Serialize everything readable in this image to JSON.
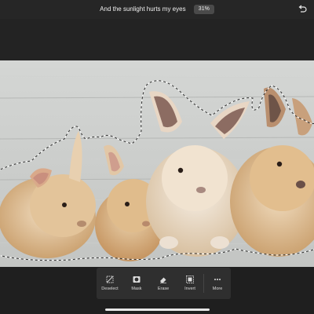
{
  "header": {
    "title": "And the sunlight hurts my eyes",
    "zoom": "31%",
    "undo_icon": "undo-arrow-icon"
  },
  "toolbar": {
    "items": [
      {
        "label": "Deselect",
        "icon": "deselect-icon"
      },
      {
        "label": "Mask",
        "icon": "mask-icon"
      },
      {
        "label": "Erase",
        "icon": "eraser-icon"
      },
      {
        "label": "Invert",
        "icon": "invert-icon"
      },
      {
        "label": "More",
        "icon": "more-dots-icon"
      }
    ]
  },
  "colors": {
    "background": "#1f1f1f",
    "toolbar": "#2f2f2f",
    "wood": "#c9cbc9",
    "bunny_fur": "#d9b88a",
    "selection_outline": "#ffffff"
  }
}
